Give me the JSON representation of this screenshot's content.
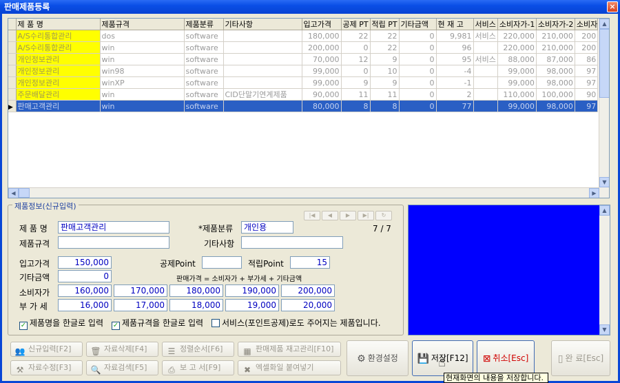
{
  "window": {
    "title": "판매제품등록",
    "close": "×"
  },
  "grid": {
    "columns": [
      "제 품 명",
      "제품규격",
      "제품분류",
      "기타사항",
      "입고가격",
      "공제 PT",
      "적립 PT",
      "기타금액",
      "현 재 고",
      "서비스",
      "소비자가-1",
      "소비자가-2",
      "소비자"
    ],
    "rows": [
      [
        "A/S수리통합관리",
        "dos",
        "software",
        "",
        "180,000",
        "22",
        "22",
        "0",
        "9,981",
        "서비스",
        "220,000",
        "210,000",
        "200"
      ],
      [
        "A/S수리통합관리",
        "win",
        "software",
        "",
        "200,000",
        "0",
        "22",
        "0",
        "96",
        "",
        "220,000",
        "210,000",
        "200"
      ],
      [
        "개인정보관리",
        "win",
        "software",
        "",
        "70,000",
        "12",
        "9",
        "0",
        "95",
        "서비스",
        "88,000",
        "87,000",
        "86"
      ],
      [
        "개인정보관리",
        "win98",
        "software",
        "",
        "99,000",
        "0",
        "10",
        "0",
        "-4",
        "",
        "99,000",
        "98,000",
        "97"
      ],
      [
        "개인정보관리",
        "winXP",
        "software",
        "",
        "99,000",
        "9",
        "9",
        "0",
        "-1",
        "",
        "99,000",
        "98,000",
        "97"
      ],
      [
        "주문배달관리",
        "win",
        "software",
        "CID단말기연계제품",
        "90,000",
        "11",
        "11",
        "0",
        "2",
        "",
        "110,000",
        "100,000",
        "90"
      ],
      [
        "판매고객관리",
        "win",
        "software",
        "",
        "80,000",
        "8",
        "8",
        "0",
        "77",
        "",
        "99,000",
        "98,000",
        "97"
      ]
    ],
    "selected_row": 6
  },
  "form": {
    "group_title": "제품정보(신규입력)",
    "labels": {
      "name": "제 품 명",
      "category": "*제품분류",
      "spec": "제품규격",
      "etc": "기타사항",
      "cost": "입고가격",
      "deduct_point": "공제Point",
      "accrue_point": "적립Point",
      "etc_amount": "기타금액",
      "formula": "판매가격 = 소비자가 + 부가세 + 기타금액",
      "retail": "소비자가",
      "vat": "부 가 세"
    },
    "values": {
      "name": "판매고객관리",
      "category": "개인용",
      "spec": "",
      "etc": "",
      "cost": "150,000",
      "deduct_point": "",
      "accrue_point": "15",
      "etc_amount": "0",
      "retail": [
        "160,000",
        "170,000",
        "180,000",
        "190,000",
        "200,000"
      ],
      "vat": [
        "16,000",
        "17,000",
        "18,000",
        "19,000",
        "20,000"
      ]
    },
    "record_counter": "7 / 7",
    "checkboxes": [
      {
        "label": "제품명을 한글로 입력",
        "checked": true
      },
      {
        "label": "제품규격을 한글로 입력",
        "checked": true
      },
      {
        "label": "서비스(포인트공제)로도 주어지는 제품입니다.",
        "checked": false
      }
    ]
  },
  "buttons": {
    "new": "신규입력[F2]",
    "edit": "자료수정[F3]",
    "delete": "자료삭제[F4]",
    "search": "자료검색[F5]",
    "sort": "정렬순서[F6]",
    "report": "보 고 서[F9]",
    "stock": "판매제품 재고관리[F10]",
    "excel": "엑셀화일 붙여넣기",
    "settings": "환경설정",
    "save": "저장[F12]",
    "cancel": "취소[Esc]",
    "done": "완 료[Esc]"
  },
  "tooltip": "현재화면의 내용을 저장합니다.",
  "colors": {
    "title_bar": "#0a4ee6",
    "selected_row": "#2a5fc4",
    "name_cell": "#ffff00",
    "panel": "#0000ff",
    "cancel_text": "#d00000"
  }
}
